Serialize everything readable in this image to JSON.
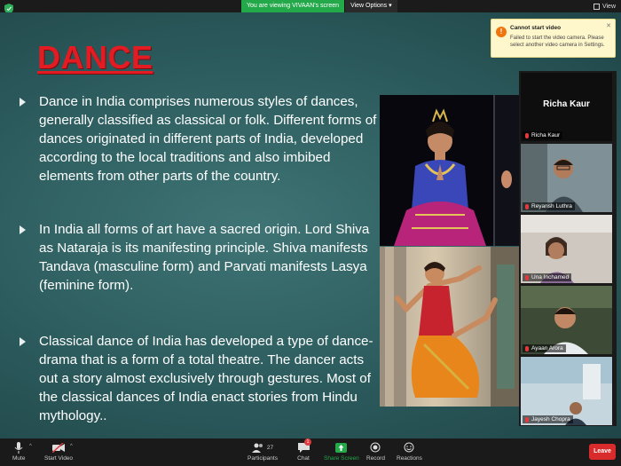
{
  "banner": {
    "viewing": "You are viewing VIVAAN's screen",
    "view_options": "View Options",
    "view_button": "View"
  },
  "slide": {
    "title": "DANCE",
    "bullets": [
      "Dance in India comprises numerous styles of dances, generally classified as classical or folk. Different forms of dances originated in different parts of India, developed according to the local traditions and also imbibed elements from other parts of the country.",
      "In India all forms of art have a sacred origin. Lord Shiva as Nataraja is its manifesting principle. Shiva manifests Tandava (masculine form) and Parvati manifests Lasya (feminine form).",
      "Classical dance of India has developed a type of dance-drama that is a form of a total theatre. The dancer acts out a story almost exclusively through gestures. Most of the classical dances of India enact stories from Hindu mythology.."
    ]
  },
  "notification": {
    "title": "Cannot start video",
    "body": "Failed to start the video camera. Please select another video camera in Settings."
  },
  "participants": [
    {
      "name": "Richa Kaur",
      "big_name": "Richa Kaur"
    },
    {
      "name": "Reyansh Luthra"
    },
    {
      "name": "Una Inchamed"
    },
    {
      "name": "Ayaan Arora"
    },
    {
      "name": "Jayesh Chopra"
    }
  ],
  "toolbar": {
    "mute": "Mute",
    "start_video": "Start Video",
    "participants": "Participants",
    "participants_count": "27",
    "chat": "Chat",
    "chat_badge": "1",
    "share_screen": "Share Screen",
    "record": "Record",
    "reactions": "Reactions",
    "leave": "Leave"
  },
  "colors": {
    "title_red": "#e31b23",
    "share_green": "#23a94a",
    "leave_red": "#d92b2b"
  }
}
